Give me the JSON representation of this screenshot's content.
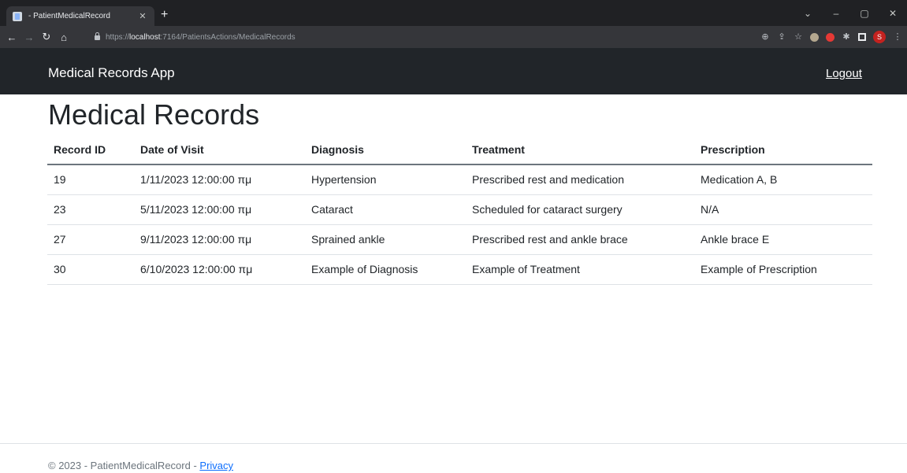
{
  "browser": {
    "tab_title": "- PatientMedicalRecord",
    "new_tab": "+",
    "url_prefix": "https://",
    "url_host": "localhost",
    "url_path": ":7164/PatientsActions/MedicalRecords",
    "profile_initial": "S"
  },
  "navbar": {
    "brand": "Medical Records App",
    "logout": "Logout"
  },
  "page": {
    "title": "Medical Records"
  },
  "table": {
    "headers": [
      "Record ID",
      "Date of Visit",
      "Diagnosis",
      "Treatment",
      "Prescription"
    ],
    "rows": [
      [
        "19",
        "1/11/2023 12:00:00 πμ",
        "Hypertension",
        "Prescribed rest and medication",
        "Medication A, B"
      ],
      [
        "23",
        "5/11/2023 12:00:00 πμ",
        "Cataract",
        "Scheduled for cataract surgery",
        "N/A"
      ],
      [
        "27",
        "9/11/2023 12:00:00 πμ",
        "Sprained ankle",
        "Prescribed rest and ankle brace",
        "Ankle brace E"
      ],
      [
        "30",
        "6/10/2023 12:00:00 πμ",
        "Example of Diagnosis",
        "Example of Treatment",
        "Example of Prescription"
      ]
    ]
  },
  "footer": {
    "text": "© 2023 - PatientMedicalRecord - ",
    "privacy": "Privacy"
  },
  "colors": {
    "navbar_bg": "#212529",
    "link": "#0d6efd"
  }
}
